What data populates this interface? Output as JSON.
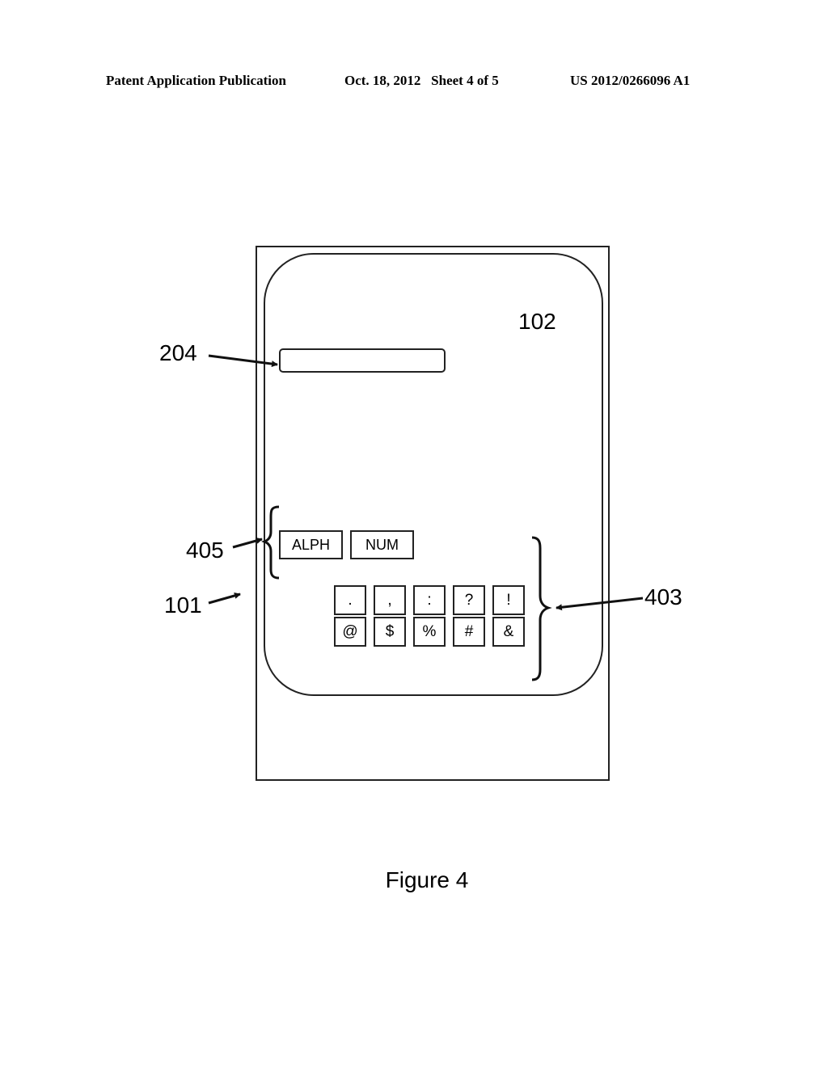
{
  "header": {
    "publication": "Patent Application Publication",
    "date_sheet": "Oct. 18, 2012   Sheet 4 of 5",
    "number": "US 2012/0266096 A1"
  },
  "labels": {
    "device": "101",
    "screen": "102",
    "text_field": "204",
    "keypad": "403",
    "mode_buttons": "405"
  },
  "mode_buttons": [
    "ALPH",
    "NUM"
  ],
  "keypad": {
    "row1": [
      ".",
      ",",
      ":",
      "?",
      "!"
    ],
    "row2": [
      "@",
      "$",
      "%",
      "#",
      "&"
    ]
  },
  "caption": "Figure 4"
}
